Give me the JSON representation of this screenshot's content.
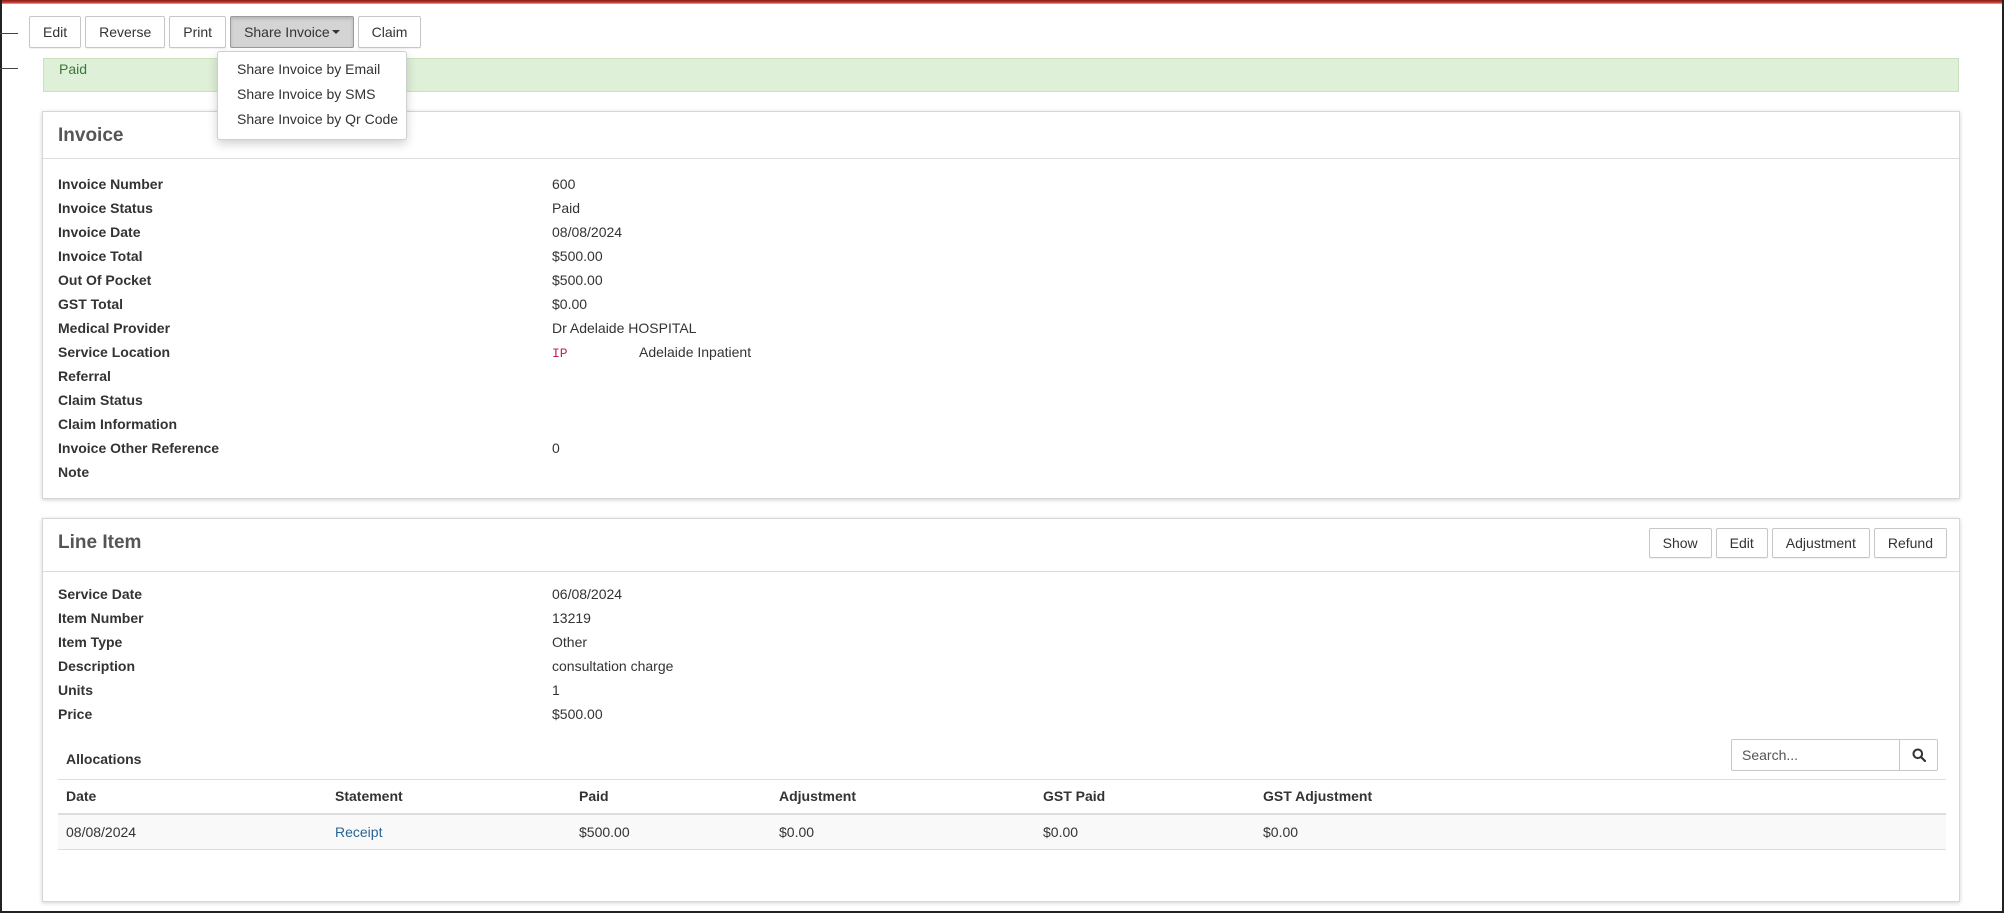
{
  "toolbar": {
    "edit": "Edit",
    "reverse": "Reverse",
    "print": "Print",
    "share_invoice": "Share Invoice",
    "claim": "Claim"
  },
  "share_menu": [
    "Share Invoice by Email",
    "Share Invoice by SMS",
    "Share Invoice by Qr Code"
  ],
  "status_banner": "Paid",
  "invoice": {
    "title": "Invoice",
    "fields": [
      {
        "label": "Invoice Number",
        "value": "600"
      },
      {
        "label": "Invoice Status",
        "value": "Paid"
      },
      {
        "label": "Invoice Date",
        "value": "08/08/2024"
      },
      {
        "label": "Invoice Total",
        "value": "$500.00"
      },
      {
        "label": "Out Of Pocket",
        "value": "$500.00"
      },
      {
        "label": "GST Total",
        "value": "$0.00"
      },
      {
        "label": "Medical Provider",
        "value": "Dr Adelaide HOSPITAL"
      },
      {
        "label": "Service Location",
        "code": "IP",
        "value": "Adelaide Inpatient"
      },
      {
        "label": "Referral",
        "value": ""
      },
      {
        "label": "Claim Status",
        "value": ""
      },
      {
        "label": "Claim Information",
        "value": ""
      },
      {
        "label": "Invoice Other Reference",
        "value": "0"
      },
      {
        "label": "Note",
        "value": ""
      }
    ]
  },
  "line_item": {
    "title": "Line Item",
    "actions": {
      "show": "Show",
      "edit": "Edit",
      "adjustment": "Adjustment",
      "refund": "Refund"
    },
    "fields": [
      {
        "label": "Service Date",
        "value": "06/08/2024"
      },
      {
        "label": "Item Number",
        "value": "13219"
      },
      {
        "label": "Item Type",
        "value": "Other"
      },
      {
        "label": "Description",
        "value": "consultation charge"
      },
      {
        "label": "Units",
        "value": "1"
      },
      {
        "label": "Price",
        "value": "$500.00"
      }
    ],
    "allocations": {
      "title": "Allocations",
      "search_placeholder": "Search...",
      "columns": [
        "Date",
        "Statement",
        "Paid",
        "Adjustment",
        "GST Paid",
        "GST Adjustment"
      ],
      "rows": [
        {
          "date": "08/08/2024",
          "statement": "Receipt",
          "paid": "$500.00",
          "adjustment": "$0.00",
          "gst_paid": "$0.00",
          "gst_adjustment": "$0.00"
        }
      ]
    }
  },
  "colors": {
    "success_bg": "#dff0d8",
    "success_text": "#3c763d",
    "link": "#2a6496",
    "code": "#c7254e",
    "accent_rule": "#c0392b"
  },
  "icons": {
    "search": "search-icon",
    "caret": "caret-down-icon"
  }
}
